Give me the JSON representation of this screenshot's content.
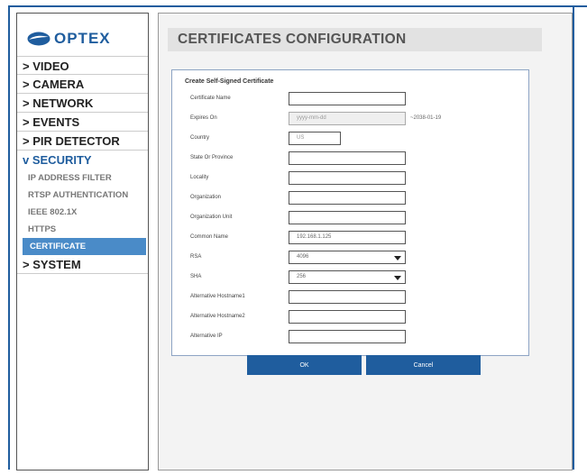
{
  "brand": {
    "logo_text": "OPTEX",
    "accent": "#1f5d9e",
    "selected_bg": "#4a8bc8"
  },
  "sidebar": {
    "items": [
      {
        "label": "> VIDEO"
      },
      {
        "label": "> CAMERA"
      },
      {
        "label": "> NETWORK"
      },
      {
        "label": "> EVENTS"
      },
      {
        "label": "> PIR DETECTOR"
      }
    ],
    "security": {
      "label": "v SECURITY",
      "sub_items": [
        {
          "label": "IP ADDRESS FILTER"
        },
        {
          "label": "RTSP AUTHENTICATION"
        },
        {
          "label": "IEEE 802.1X"
        },
        {
          "label": "HTTPS"
        },
        {
          "label": "CERTIFICATE",
          "selected": true
        }
      ]
    },
    "system_label": "> SYSTEM"
  },
  "page": {
    "title": "CERTIFICATES CONFIGURATION"
  },
  "form": {
    "header": "Create Self-Signed Certificate",
    "fields": [
      {
        "label": "Certificate Name",
        "value": ""
      },
      {
        "label": "Expires On",
        "placeholder": "yyyy-mm-dd",
        "hint": "~2038-01-19"
      },
      {
        "label": "Country",
        "value": "US"
      },
      {
        "label": "State Or Province",
        "value": ""
      },
      {
        "label": "Locality",
        "value": ""
      },
      {
        "label": "Organization",
        "value": ""
      },
      {
        "label": "Organization Unit",
        "value": ""
      },
      {
        "label": "Common Name",
        "value": "192.168.1.125"
      },
      {
        "label": "RSA",
        "value": "4096",
        "options_icon": "caret-down-icon"
      },
      {
        "label": "SHA",
        "value": "256",
        "options_icon": "caret-down-icon"
      },
      {
        "label": "Alternative Hostname1",
        "value": ""
      },
      {
        "label": "Alternative Hostname2",
        "value": ""
      },
      {
        "label": "Alternative IP",
        "value": ""
      }
    ]
  },
  "buttons": {
    "ok": "OK",
    "cancel": "Cancel"
  }
}
